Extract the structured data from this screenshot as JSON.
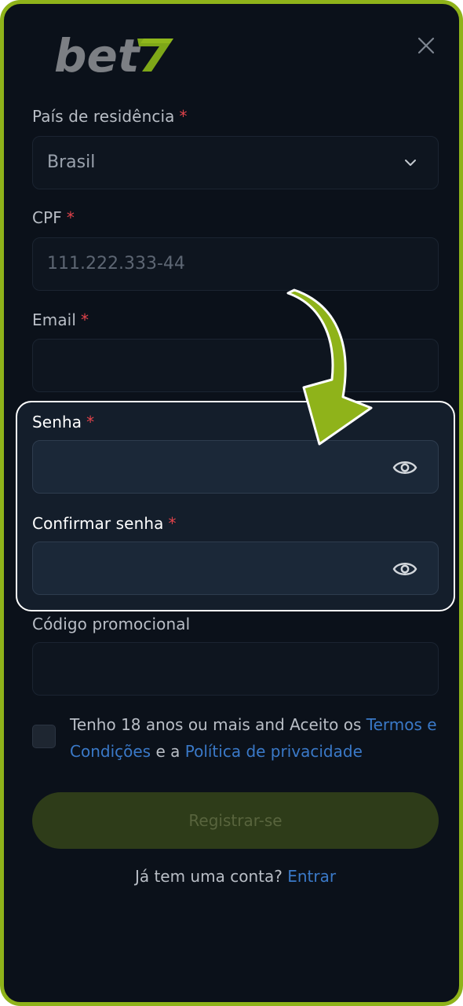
{
  "brand": {
    "logo_text": "bet",
    "logo_mark": "7",
    "accent": "#8fb31a",
    "link_color": "#3a79c8",
    "required_color": "#e2434b"
  },
  "form": {
    "country": {
      "label": "País de residência",
      "value": "Brasil"
    },
    "cpf": {
      "label": "CPF",
      "placeholder": "111.222.333-44"
    },
    "email": {
      "label": "Email",
      "value": ""
    },
    "password": {
      "label": "Senha",
      "value": ""
    },
    "confirm_password": {
      "label": "Confirmar senha",
      "value": ""
    },
    "promo": {
      "label": "Código promocional",
      "value": ""
    },
    "required_mark": "*"
  },
  "terms": {
    "text_1": "Tenho 18 anos ou mais and Aceito os",
    "link_terms": "Termos e Condições",
    "text_2": "e a",
    "link_privacy": "Política de privacidade",
    "checked": false
  },
  "register_button": "Registrar-se",
  "login_prompt": {
    "text": "Já tem uma conta?",
    "link": "Entrar"
  },
  "icons": [
    "close-icon",
    "chevron-down-icon",
    "eye-icon",
    "arrow-annotation"
  ]
}
